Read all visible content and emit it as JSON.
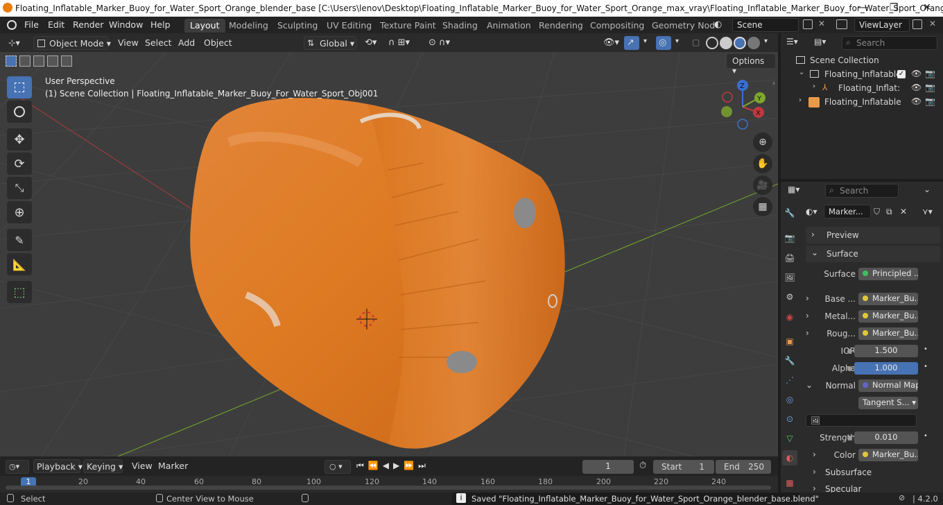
{
  "window": {
    "title": "Floating_Inflatable_Marker_Buoy_for_Water_Sport_Orange_blender_base [C:\\Users\\lenov\\Desktop\\Floating_Inflatable_Marker_Buoy_for_Water_Sport_Orange_max_vray\\Floating_Inflatable_Marker_Buoy_for_Water_Sport_Orange...",
    "minimize": "—",
    "maximize": "❐",
    "close": "✕"
  },
  "menu": {
    "file": "File",
    "edit": "Edit",
    "render": "Render",
    "window": "Window",
    "help": "Help"
  },
  "workspaces": [
    "Layout",
    "Modeling",
    "Sculpting",
    "UV Editing",
    "Texture Paint",
    "Shading",
    "Animation",
    "Rendering",
    "Compositing",
    "Geometry Nod"
  ],
  "scene": {
    "name": "Scene",
    "view_layer": "ViewLayer"
  },
  "viewport_header": {
    "mode": "Object Mode",
    "view": "View",
    "select": "Select",
    "add": "Add",
    "object": "Object",
    "orientation": "Global",
    "options": "Options"
  },
  "viewport": {
    "perspective": "User Perspective",
    "collection_info": "(1) Scene Collection | Floating_Inflatable_Marker_Buoy_For_Water_Sport_Obj001",
    "gizmo": {
      "x": "X",
      "y": "Y",
      "z": "Z"
    },
    "colors": {
      "bg": "#3d3d3d",
      "grid": "#4a4a4a",
      "x_axis": "#9b3a3a",
      "y_axis": "#6f9a2b",
      "buoy": "#e07f25"
    }
  },
  "outliner": {
    "search_placeholder": "Search",
    "root": "Scene Collection",
    "items": [
      {
        "label": "Floating_Inflatable"
      },
      {
        "label": "Floating_Inflat:"
      },
      {
        "label": "Floating_Inflatable"
      }
    ]
  },
  "properties": {
    "search_placeholder": "Search",
    "material_name": "Marker...",
    "sections": {
      "preview": "Preview",
      "surface": "Surface",
      "subsurface": "Subsurface",
      "specular": "Specular"
    },
    "rows": [
      {
        "label": "Surface",
        "value": "Principled ...",
        "socket": "#3fbf5f"
      },
      {
        "label": "Base ...",
        "value": "Marker_Bu...",
        "socket": "#e0c73a",
        "expand": true
      },
      {
        "label": "Metal...",
        "value": "Marker_Bu...",
        "socket": "#e0c73a",
        "expand": true
      },
      {
        "label": "Roug...",
        "value": "Marker_Bu...",
        "socket": "#e0c73a",
        "expand": true
      },
      {
        "label": "IOR",
        "value": "1.500",
        "socket": "#8a8a8a",
        "num": true
      },
      {
        "label": "Alpha",
        "value": "1.000",
        "socket": "#8a8a8a",
        "num": true,
        "blue": true
      },
      {
        "label": "Normal",
        "value": "Normal Map",
        "socket": "#6464c8",
        "expand": true
      },
      {
        "label": "",
        "value": "Tangent S...",
        "dropdown": true
      },
      {
        "label": "",
        "value": "",
        "image": true
      },
      {
        "label": "Strength",
        "value": "0.010",
        "socket": "#8a8a8a",
        "num": true
      },
      {
        "label": "Color",
        "value": "Marker_Bu...",
        "socket": "#e0c73a",
        "expand": true
      }
    ]
  },
  "timeline": {
    "playback": "Playback",
    "keying": "Keying",
    "view": "View",
    "marker": "Marker",
    "current_frame": "1",
    "start_label": "Start",
    "start": "1",
    "end_label": "End",
    "end": "250",
    "ticks": [
      "1",
      "20",
      "40",
      "60",
      "80",
      "100",
      "120",
      "140",
      "160",
      "180",
      "200",
      "220",
      "240"
    ]
  },
  "status": {
    "select": "Select",
    "center": "Center View to Mouse",
    "message": "Saved \"Floating_Inflatable_Marker_Buoy_for_Water_Sport_Orange_blender_base.blend\"",
    "version": "4.2.0"
  }
}
